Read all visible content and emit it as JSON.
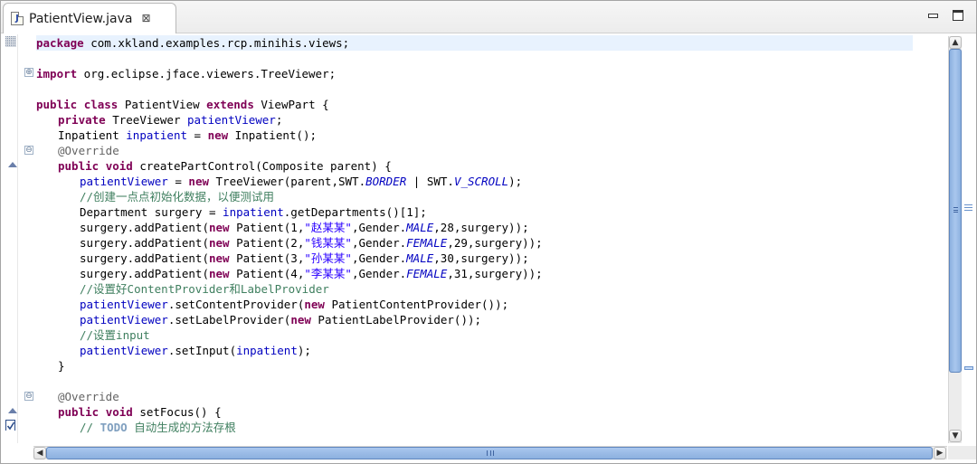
{
  "tab": {
    "icon_letter": "J",
    "title": "PatientView.java",
    "close_glyph": "⊠"
  },
  "controls": {
    "minimize": "minimize-icon",
    "maximize": "maximize-icon"
  },
  "colors": {
    "keyword": "#7f0055",
    "field": "#0000c0",
    "string": "#2a00ff",
    "comment": "#3f7f5f",
    "annotation": "#646464",
    "current_line": "#e8f2fe",
    "scroll_thumb": "#8cb0df"
  },
  "code": {
    "l1": {
      "kw": "package",
      "rest": " com.xkland.examples.rcp.minihis.views;"
    },
    "l3": {
      "kw": "import",
      "rest": " org.eclipse.jface.viewers.TreeViewer;"
    },
    "l5": {
      "kw1": "public",
      "kw2": "class",
      "name": " PatientView ",
      "kw3": "extends",
      "rest": " ViewPart {"
    },
    "l6": {
      "kw": "private",
      "type": " TreeViewer ",
      "field": "patientViewer",
      "rest": ";"
    },
    "l7": {
      "type": "Inpatient ",
      "field": "inpatient",
      "mid": " = ",
      "kw": "new",
      "rest": " Inpatient();"
    },
    "l8": {
      "ann": "@Override"
    },
    "l9": {
      "kw1": "public",
      "kw2": "void",
      "rest": " createPartControl(Composite parent) {"
    },
    "l10": {
      "field": "patientViewer",
      "mid": " = ",
      "kw": "new",
      "a": " TreeViewer(parent,SWT.",
      "c1": "BORDER",
      "b": " | SWT.",
      "c2": "V_SCROLL",
      "rest": ");"
    },
    "l11": {
      "cmt": "//创建一点点初始化数据，以便测试用"
    },
    "l12": {
      "a": "Department surgery = ",
      "field": "inpatient",
      "rest": ".getDepartments()[1];"
    },
    "l13": {
      "a": "surgery.addPatient(",
      "kw": "new",
      "b": " Patient(1,",
      "str": "\"赵某某\"",
      "c": ",Gender.",
      "const": "MALE",
      "rest": ",28,surgery));"
    },
    "l14": {
      "a": "surgery.addPatient(",
      "kw": "new",
      "b": " Patient(2,",
      "str": "\"钱某某\"",
      "c": ",Gender.",
      "const": "FEMALE",
      "rest": ",29,surgery));"
    },
    "l15": {
      "a": "surgery.addPatient(",
      "kw": "new",
      "b": " Patient(3,",
      "str": "\"孙某某\"",
      "c": ",Gender.",
      "const": "MALE",
      "rest": ",30,surgery));"
    },
    "l16": {
      "a": "surgery.addPatient(",
      "kw": "new",
      "b": " Patient(4,",
      "str": "\"李某某\"",
      "c": ",Gender.",
      "const": "FEMALE",
      "rest": ",31,surgery));"
    },
    "l17": {
      "cmt": "//设置好ContentProvider和LabelProvider"
    },
    "l18": {
      "field": "patientViewer",
      "a": ".setContentProvider(",
      "kw": "new",
      "rest": " PatientContentProvider());"
    },
    "l19": {
      "field": "patientViewer",
      "a": ".setLabelProvider(",
      "kw": "new",
      "rest": " PatientLabelProvider());"
    },
    "l20": {
      "cmt": "//设置input"
    },
    "l21": {
      "field": "patientViewer",
      "a": ".setInput(",
      "field2": "inpatient",
      "rest": ");"
    },
    "l22": {
      "text": "}"
    },
    "l24": {
      "ann": "@Override"
    },
    "l25": {
      "kw1": "public",
      "kw2": "void",
      "rest": " setFocus() {"
    },
    "l26": {
      "cmt_prefix": "// ",
      "todo": "TODO",
      "cmt": " 自动生成的方法存根"
    }
  },
  "folds": {
    "expand": "⊕",
    "collapse": "⊖"
  },
  "scroll": {
    "up": "▲",
    "down": "▼",
    "left": "◀",
    "right": "▶"
  }
}
